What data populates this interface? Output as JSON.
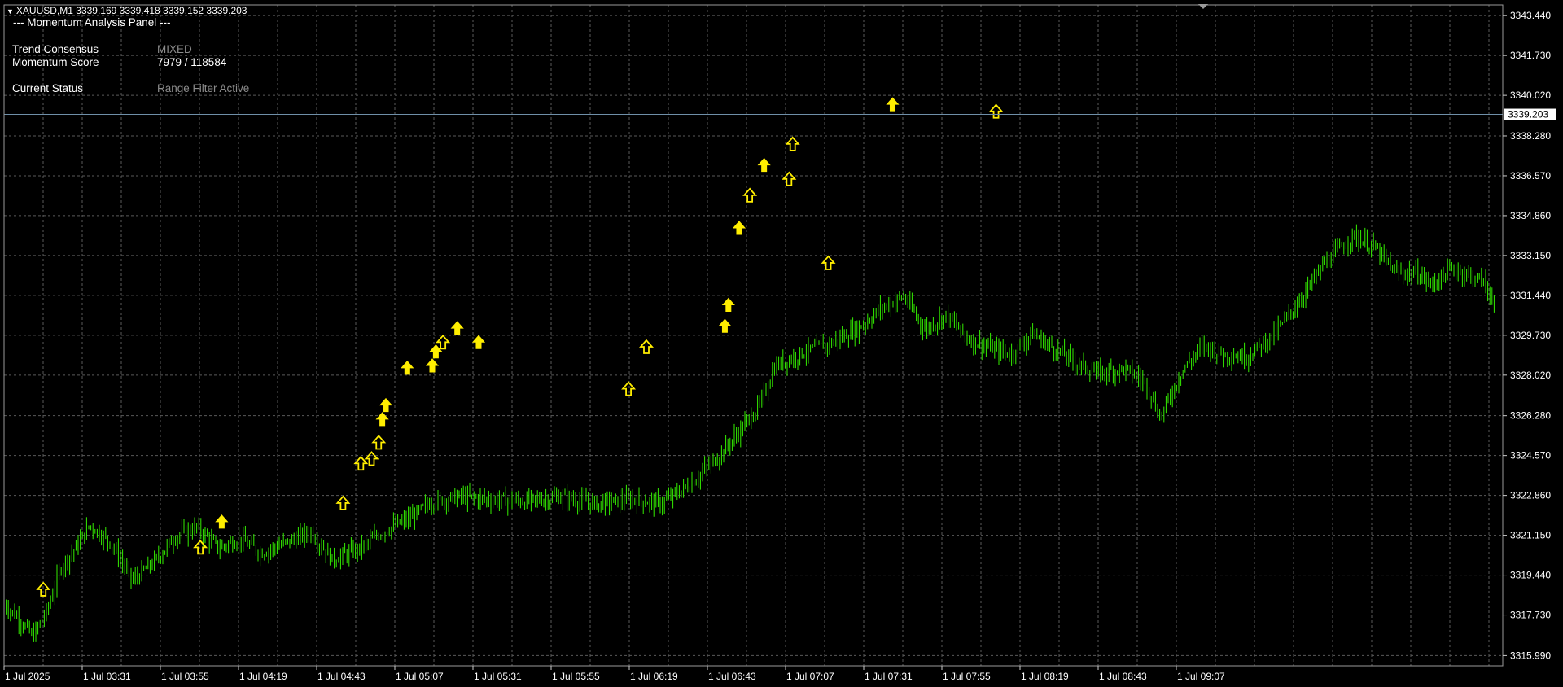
{
  "header": {
    "symbol_line": "XAUUSD,M1  3339.169 3339.418 3339.152 3339.203",
    "panel_title": "--- Momentum Analysis Panel ---"
  },
  "panel": {
    "rows": [
      {
        "label": "Trend Consensus",
        "value": "MIXED",
        "value_color": "#8c8c8c"
      },
      {
        "label": "Momentum Score",
        "value": "7979 / 118584",
        "value_color": "#ffffff"
      },
      {
        "label": "Current Status",
        "value": "Range Filter Active",
        "value_color": "#8c8c8c"
      }
    ]
  },
  "colors": {
    "background": "#000000",
    "grid": "#5a5a5a",
    "candle": "#33ee00",
    "arrow": "#ffee00",
    "price_line": "#6f8fa8",
    "text": "#ffffff"
  },
  "current_price": "3339.203",
  "chart_data": {
    "type": "line",
    "y_ticks": [
      "3343.440",
      "3341.730",
      "3340.020",
      "3338.280",
      "3336.570",
      "3334.860",
      "3333.150",
      "3331.440",
      "3329.730",
      "3328.020",
      "3326.280",
      "3324.570",
      "3322.860",
      "3321.150",
      "3319.440",
      "3317.730",
      "3315.990"
    ],
    "x_ticks": [
      "1 Jul 2025",
      "1 Jul 03:31",
      "1 Jul 03:55",
      "1 Jul 04:19",
      "1 Jul 04:43",
      "1 Jul 05:07",
      "1 Jul 05:31",
      "1 Jul 05:55",
      "1 Jul 06:19",
      "1 Jul 06:43",
      "1 Jul 07:07",
      "1 Jul 07:31",
      "1 Jul 07:55",
      "1 Jul 08:19",
      "1 Jul 08:43",
      "1 Jul 09:07"
    ],
    "ylim": [
      3315.55,
      3343.9
    ],
    "x_range": [
      0,
      21
    ],
    "price_path": [
      [
        0,
        3318.2
      ],
      [
        0.2,
        3317.6
      ],
      [
        0.4,
        3316.8
      ],
      [
        0.6,
        3317.9
      ],
      [
        0.8,
        3319.8
      ],
      [
        1.0,
        3320.6
      ],
      [
        1.2,
        3321.6
      ],
      [
        1.5,
        3320.8
      ],
      [
        1.8,
        3319.2
      ],
      [
        2.1,
        3320.0
      ],
      [
        2.4,
        3321.1
      ],
      [
        2.7,
        3321.5
      ],
      [
        3.0,
        3320.6
      ],
      [
        3.3,
        3321.0
      ],
      [
        3.6,
        3320.4
      ],
      [
        4.0,
        3320.9
      ],
      [
        4.3,
        3321.3
      ],
      [
        4.6,
        3320.1
      ],
      [
        5.0,
        3320.6
      ],
      [
        5.3,
        3321.3
      ],
      [
        5.7,
        3321.9
      ],
      [
        6.0,
        3322.6
      ],
      [
        6.4,
        3322.8
      ],
      [
        6.8,
        3322.7
      ],
      [
        7.3,
        3322.6
      ],
      [
        7.8,
        3322.8
      ],
      [
        8.3,
        3322.5
      ],
      [
        8.8,
        3322.7
      ],
      [
        9.2,
        3322.5
      ],
      [
        9.6,
        3323.3
      ],
      [
        10.0,
        3324.5
      ],
      [
        10.3,
        3325.6
      ],
      [
        10.6,
        3326.8
      ],
      [
        10.8,
        3328.4
      ],
      [
        11.2,
        3329.0
      ],
      [
        11.6,
        3329.4
      ],
      [
        12.0,
        3330.1
      ],
      [
        12.3,
        3330.9
      ],
      [
        12.6,
        3331.4
      ],
      [
        12.9,
        3330.0
      ],
      [
        13.2,
        3330.6
      ],
      [
        13.5,
        3329.6
      ],
      [
        13.8,
        3329.2
      ],
      [
        14.1,
        3328.9
      ],
      [
        14.4,
        3329.8
      ],
      [
        14.7,
        3329.2
      ],
      [
        15.0,
        3328.6
      ],
      [
        15.3,
        3328.1
      ],
      [
        15.7,
        3328.3
      ],
      [
        16.0,
        3327.7
      ],
      [
        16.2,
        3326.2
      ],
      [
        16.5,
        3328.2
      ],
      [
        16.8,
        3329.3
      ],
      [
        17.1,
        3328.9
      ],
      [
        17.4,
        3328.8
      ],
      [
        17.8,
        3329.8
      ],
      [
        18.1,
        3331.0
      ],
      [
        18.5,
        3332.8
      ],
      [
        18.9,
        3334.0
      ],
      [
        19.2,
        3333.5
      ],
      [
        19.5,
        3332.4
      ],
      [
        19.8,
        3332.4
      ],
      [
        20.0,
        3331.9
      ],
      [
        20.3,
        3332.6
      ],
      [
        20.7,
        3332.1
      ],
      [
        20.9,
        3331.1
      ]
    ]
  }
}
